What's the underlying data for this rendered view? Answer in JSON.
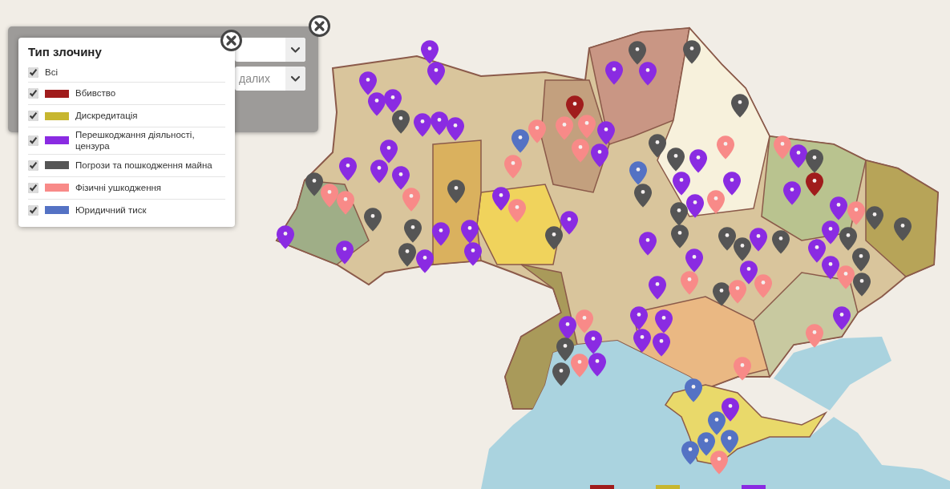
{
  "filter_panel": {
    "filters": [
      {
        "kind": "select",
        "expanded": false
      },
      {
        "kind": "select",
        "expanded": false,
        "value": "далих"
      }
    ]
  },
  "legend": {
    "title": "Тип злочину",
    "items": [
      {
        "label": "Всі",
        "checked": true
      },
      {
        "label": "Вбивство",
        "checked": true,
        "color": "#a01c1c"
      },
      {
        "label": "Дискредитація",
        "checked": true,
        "color": "#c7b62f"
      },
      {
        "label": "Перешкоджання діяльності, цензура",
        "checked": true,
        "color": "#8a2be2"
      },
      {
        "label": "Погрози та пошкодження майна",
        "checked": true,
        "color": "#555555"
      },
      {
        "label": "Фізичні ушкодження",
        "checked": true,
        "color": "#f88a88"
      },
      {
        "label": "Юридичний тиск",
        "checked": true,
        "color": "#5472c4"
      }
    ]
  },
  "map": {
    "pins": [
      {
        "color": "#8a2be2"
      },
      {
        "color": "#8a2be2"
      },
      {
        "color": "#8a2be2"
      },
      {
        "color": "#8a2be2"
      },
      {
        "color": "#8a2be2"
      },
      {
        "color": "#555555"
      },
      {
        "color": "#8a2be2"
      },
      {
        "color": "#8a2be2"
      },
      {
        "color": "#8a2be2"
      },
      {
        "color": "#8a2be2"
      },
      {
        "color": "#8a2be2"
      },
      {
        "color": "#8a2be2"
      },
      {
        "color": "#555555"
      },
      {
        "color": "#f88a88"
      },
      {
        "color": "#f88a88"
      },
      {
        "color": "#8a2be2"
      },
      {
        "color": "#f88a88"
      },
      {
        "color": "#555555"
      },
      {
        "color": "#8a2be2"
      },
      {
        "color": "#f88a88"
      },
      {
        "color": "#555555"
      },
      {
        "color": "#555555"
      },
      {
        "color": "#8a2be2"
      },
      {
        "color": "#8a2be2"
      },
      {
        "color": "#8a2be2"
      },
      {
        "color": "#555555"
      },
      {
        "color": "#8a2be2"
      },
      {
        "color": "#8a2be2"
      },
      {
        "color": "#8a2be2"
      },
      {
        "color": "#8a2be2"
      },
      {
        "color": "#555555"
      },
      {
        "color": "#f88a88"
      },
      {
        "color": "#5472c4"
      },
      {
        "color": "#f88a88"
      },
      {
        "color": "#a01c1c"
      },
      {
        "color": "#f88a88"
      },
      {
        "color": "#8a2be2"
      },
      {
        "color": "#8a2be2"
      },
      {
        "color": "#f88a88"
      },
      {
        "color": "#f88a88"
      },
      {
        "color": "#8a2be2"
      },
      {
        "color": "#555555"
      },
      {
        "color": "#8a2be2"
      },
      {
        "color": "#555555"
      },
      {
        "color": "#555555"
      },
      {
        "color": "#555555"
      },
      {
        "color": "#555555"
      },
      {
        "color": "#8a2be2"
      },
      {
        "color": "#f88a88"
      },
      {
        "color": "#5472c4"
      },
      {
        "color": "#555555"
      },
      {
        "color": "#8a2be2"
      },
      {
        "color": "#8a2be2"
      },
      {
        "color": "#f88a88"
      },
      {
        "color": "#8a2be2"
      },
      {
        "color": "#555555"
      },
      {
        "color": "#555555"
      },
      {
        "color": "#8a2be2"
      },
      {
        "color": "#555555"
      },
      {
        "color": "#555555"
      },
      {
        "color": "#8a2be2"
      },
      {
        "color": "#555555"
      },
      {
        "color": "#f88a88"
      },
      {
        "color": "#8a2be2"
      },
      {
        "color": "#555555"
      },
      {
        "color": "#a01c1c"
      },
      {
        "color": "#8a2be2"
      },
      {
        "color": "#555555"
      },
      {
        "color": "#555555"
      },
      {
        "color": "#8a2be2"
      },
      {
        "color": "#f88a88"
      },
      {
        "color": "#555555"
      },
      {
        "color": "#8a2be2"
      },
      {
        "color": "#8a2be2"
      },
      {
        "color": "#8a2be2"
      },
      {
        "color": "#555555"
      },
      {
        "color": "#f88a88"
      },
      {
        "color": "#555555"
      },
      {
        "color": "#8a2be2"
      },
      {
        "color": "#f88a88"
      },
      {
        "color": "#8a2be2"
      },
      {
        "color": "#8a2be2"
      },
      {
        "color": "#f88a88"
      },
      {
        "color": "#555555"
      },
      {
        "color": "#f88a88"
      },
      {
        "color": "#8a2be2"
      },
      {
        "color": "#f88a88"
      },
      {
        "color": "#8a2be2"
      },
      {
        "color": "#8a2be2"
      },
      {
        "color": "#8a2be2"
      },
      {
        "color": "#8a2be2"
      },
      {
        "color": "#f88a88"
      },
      {
        "color": "#8a2be2"
      },
      {
        "color": "#555555"
      },
      {
        "color": "#8a2be2"
      },
      {
        "color": "#8a2be2"
      },
      {
        "color": "#f88a88"
      },
      {
        "color": "#555555"
      },
      {
        "color": "#f88a88"
      },
      {
        "color": "#5472c4"
      },
      {
        "color": "#8a2be2"
      },
      {
        "color": "#5472c4"
      },
      {
        "color": "#5472c4"
      },
      {
        "color": "#5472c4"
      },
      {
        "color": "#5472c4"
      },
      {
        "color": "#f88a88"
      }
    ]
  },
  "bottom_legend": [
    {
      "color": "#a01c1c"
    },
    {
      "color": "#c7b62f"
    },
    {
      "color": "#8a2be2"
    }
  ]
}
